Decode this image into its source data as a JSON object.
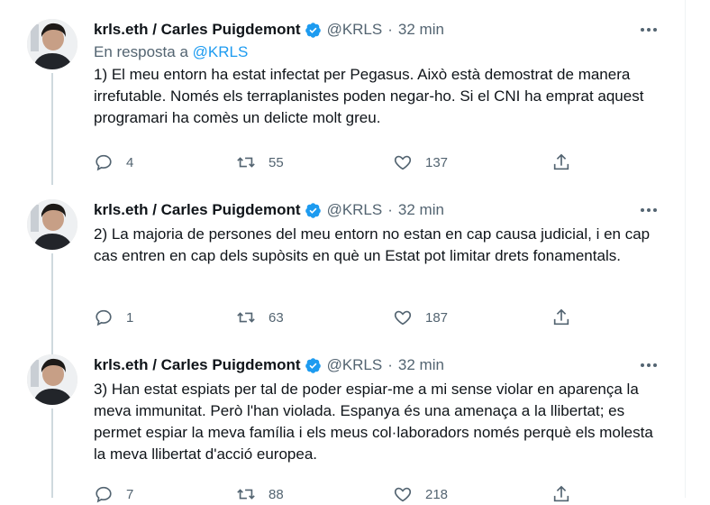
{
  "tweets": [
    {
      "name": "krls.eth / Carles Puigdemont",
      "handle": "@KRLS",
      "separator": "·",
      "time": "32 min",
      "reply_prefix": "En resposta a",
      "reply_to": "@KRLS",
      "text": "1) El meu entorn ha estat infectat per Pegasus. Això està demostrat de manera irrefutable. Només els terraplanistes poden negar-ho. Si el CNI ha emprat aquest programari ha comès un delicte molt greu.",
      "replies": "4",
      "retweets": "55",
      "likes": "137"
    },
    {
      "name": "krls.eth / Carles Puigdemont",
      "handle": "@KRLS",
      "separator": "·",
      "time": "32 min",
      "text": "2) La majoria de persones del meu entorn no estan en cap causa judicial, i en cap cas entren en cap dels supòsits en què un Estat pot limitar drets fonamentals.",
      "replies": "1",
      "retweets": "63",
      "likes": "187"
    },
    {
      "name": "krls.eth / Carles Puigdemont",
      "handle": "@KRLS",
      "separator": "·",
      "time": "32 min",
      "text": "3) Han estat espiats per tal de poder espiar-me a mi sense violar en aparença la meva immunitat. Però l'han violada. Espanya és una amenaça a la llibertat; es permet espiar la meva família i els meus col·laboradors només perquè els molesta la meva llibertat d'acció europea.",
      "replies": "7",
      "retweets": "88",
      "likes": "218"
    }
  ],
  "colors": {
    "accent": "#1d9bf0",
    "secondary_text": "#536471",
    "thread_line": "#cfd9de"
  },
  "icons": [
    "verified-badge-icon",
    "more-icon",
    "reply-icon",
    "retweet-icon",
    "like-icon",
    "share-icon"
  ]
}
